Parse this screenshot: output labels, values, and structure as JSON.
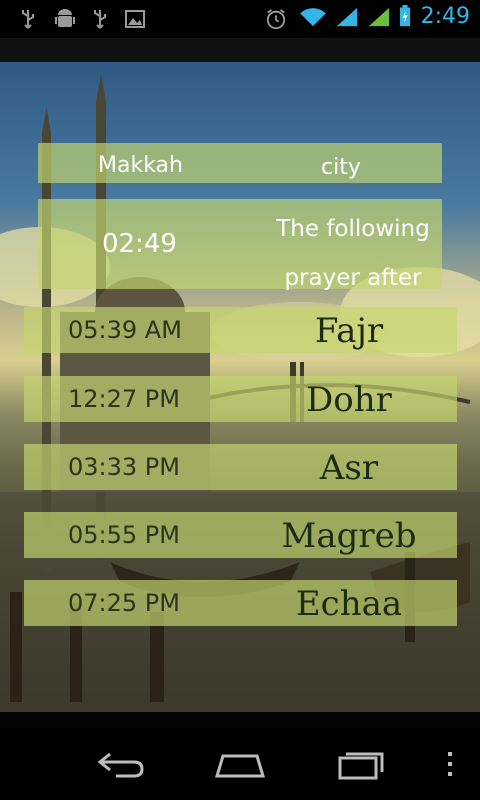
{
  "status_bar": {
    "time": "2:49",
    "icons": [
      "usb-icon",
      "android-debug-icon",
      "usb-icon",
      "image-icon",
      "alarm-icon",
      "wifi-icon",
      "signal-icon",
      "signal-icon",
      "battery-icon"
    ]
  },
  "city": {
    "name": "Makkah",
    "label": "city"
  },
  "next_prayer": {
    "time": "02:49",
    "label": "The following prayer after"
  },
  "prayers": [
    {
      "time": "05:39 AM",
      "name": "Fajr"
    },
    {
      "time": "12:27 PM",
      "name": "Dohr"
    },
    {
      "time": "03:33 PM",
      "name": "Asr"
    },
    {
      "time": "05:55 PM",
      "name": "Magreb"
    },
    {
      "time": "07:25 PM",
      "name": "Echaa"
    }
  ],
  "nav_bar": {
    "buttons": [
      "back-icon",
      "home-icon",
      "recent-apps-icon",
      "menu-icon"
    ]
  },
  "colors": {
    "status_accent": "#33b5e5",
    "panel": "#c4d66e",
    "prayer_text": "#1e2a12"
  }
}
